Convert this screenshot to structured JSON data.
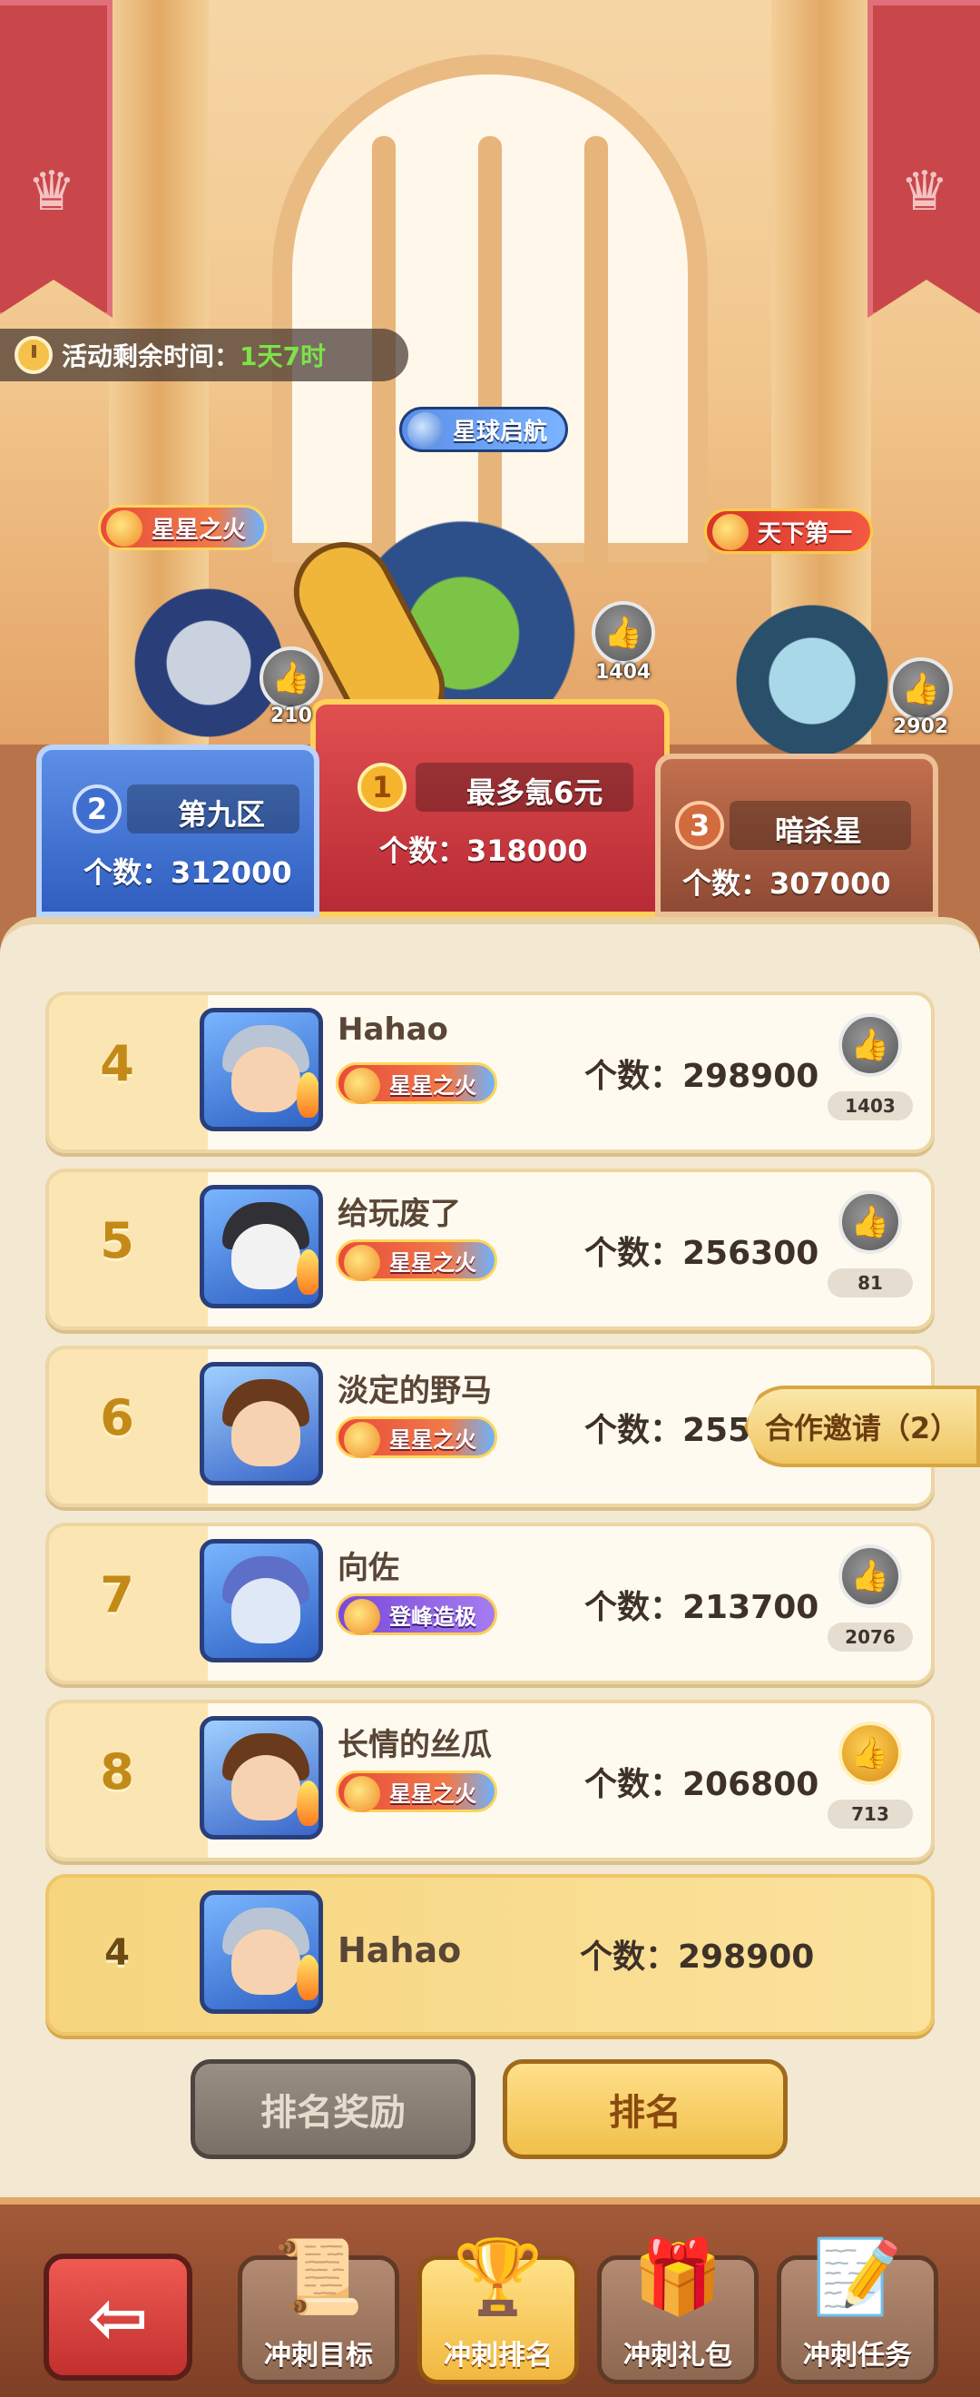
{
  "timer": {
    "label": "活动剩余时间：",
    "value": "1天7时"
  },
  "podium": {
    "first": {
      "title": "星球启航",
      "likes": "1404",
      "rank": "1",
      "name": "最多氪6元",
      "count": "个数：318000"
    },
    "second": {
      "title": "星星之火",
      "likes": "210",
      "rank": "2",
      "name": "第九区",
      "count": "个数：312000"
    },
    "third": {
      "title": "天下第一",
      "likes": "2902",
      "rank": "3",
      "name": "暗杀星",
      "count": "个数：307000"
    }
  },
  "rows": [
    {
      "rank": "4",
      "name": "Hahao",
      "title": "星星之火",
      "count": "个数：298900",
      "likes": "1403"
    },
    {
      "rank": "5",
      "name": "给玩废了",
      "title": "星星之火",
      "count": "个数：256300",
      "likes": "81"
    },
    {
      "rank": "6",
      "name": "淡定的野马",
      "title": "星星之火",
      "count": "个数：255",
      "likes": ""
    },
    {
      "rank": "7",
      "name": "向佐",
      "title": "登峰造极",
      "count": "个数：213700",
      "likes": "2076"
    },
    {
      "rank": "8",
      "name": "长情的丝瓜",
      "title": "星星之火",
      "count": "个数：206800",
      "likes": "713"
    }
  ],
  "self_row": {
    "rank": "4",
    "name": "Hahao",
    "count": "个数：298900"
  },
  "coop_invite": "合作邀请（2）",
  "tabs": {
    "reward": "排名奖励",
    "ranking": "排名"
  },
  "nav": {
    "back_icon": "back-arrow-icon",
    "items": [
      {
        "label": "冲刺目标",
        "icon": "scroll-icon"
      },
      {
        "label": "冲刺排名",
        "icon": "trophy-icon",
        "active": true
      },
      {
        "label": "冲刺礼包",
        "icon": "gift-icon"
      },
      {
        "label": "冲刺任务",
        "icon": "quest-scroll-icon"
      }
    ]
  },
  "colors": {
    "accent_gold": "#f1bf4a",
    "timer_green": "#7ce34a",
    "panel_bg": "#f3e8d2"
  }
}
